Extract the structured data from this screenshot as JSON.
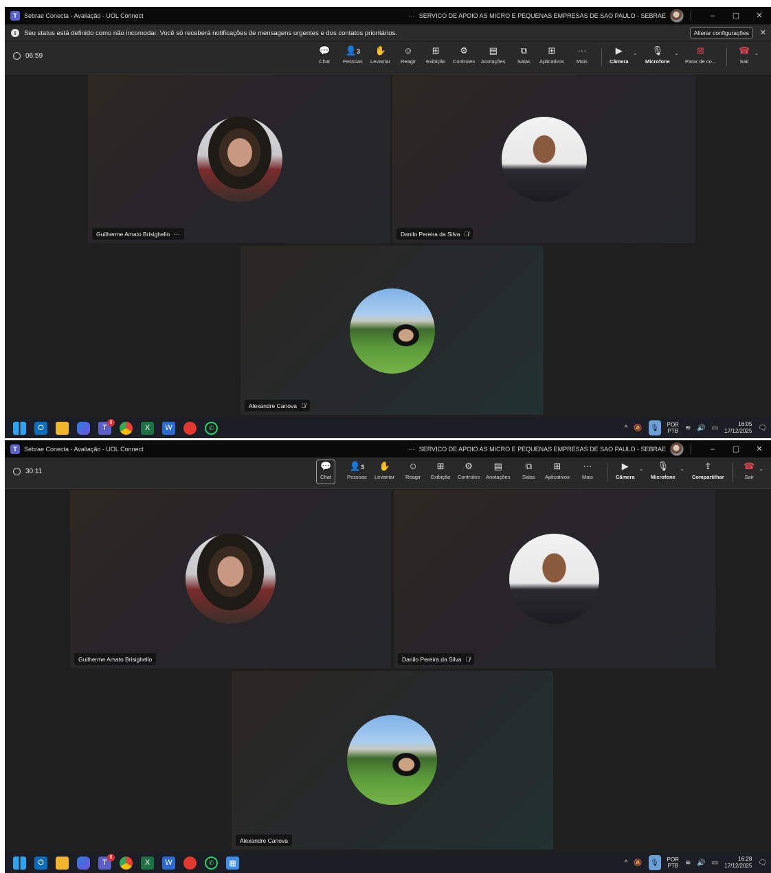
{
  "screens": [
    {
      "titlebar": {
        "app_title": "Sebrae Conecta - Avaliação - UOL Connect",
        "more": "···",
        "org_name": "SERVICO DE APOIO AS MICRO E PEQUENAS EMPRESAS DE SAO PAULO - SEBRAE",
        "minimize": "–",
        "restore": "▢",
        "close": "✕"
      },
      "banner": {
        "message": "Seu status está definido como não incomodar. Você só receberá notificações de mensagens urgentes e dos contatos prioritários.",
        "button": "Alterar configurações",
        "close": "✕"
      },
      "toolbar": {
        "timer": "06:59",
        "people_count": "3",
        "chat": "Chat",
        "people": "Pessoas",
        "raise": "Levantar",
        "react": "Reagir",
        "view": "Exibição",
        "controls": "Controles",
        "notes": "Anotações",
        "rooms": "Salas",
        "apps": "Aplicativos",
        "more": "Mais",
        "camera": "Câmera",
        "mic": "Microfone",
        "share": "Parar de co...",
        "leave": "Sair"
      },
      "participants": [
        {
          "name": "Guilherme Amato Brisighello",
          "extra": "···"
        },
        {
          "name": "Danilo Pereira da Silva",
          "extra": ""
        },
        {
          "name": "Alexandre Canova",
          "extra": ""
        }
      ],
      "taskbar": {
        "teams_badge": "6",
        "lang_top": "POR",
        "lang_bottom": "PTB",
        "time": "16:05",
        "date": "17/12/2025"
      }
    },
    {
      "titlebar": {
        "app_title": "Sebrae Conecta - Avaliação - UOL Connect",
        "more": "···",
        "org_name": "SERVICO DE APOIO AS MICRO E PEQUENAS EMPRESAS DE SAO PAULO - SEBRAE",
        "minimize": "–",
        "restore": "▢",
        "close": "✕"
      },
      "toolbar": {
        "timer": "30:11",
        "people_count": "3",
        "chat": "Chat",
        "people": "Pessoas",
        "raise": "Levantar",
        "react": "Reagir",
        "view": "Exibição",
        "controls": "Controles",
        "notes": "Anotações",
        "rooms": "Salas",
        "apps": "Aplicativos",
        "more": "Mais",
        "camera": "Câmera",
        "mic": "Microfone",
        "share": "Compartilhar",
        "leave": "Sair"
      },
      "participants": [
        {
          "name": "Guilherme Amato Brisighello",
          "extra": ""
        },
        {
          "name": "Danilo Pereira da Silva",
          "extra": ""
        },
        {
          "name": "Alexandre Canova",
          "extra": ""
        }
      ],
      "taskbar": {
        "teams_badge": "6",
        "lang_top": "POR",
        "lang_bottom": "PTB",
        "time": "16:28",
        "date": "17/12/2025"
      }
    }
  ],
  "icons": {
    "chat": "chat-bubble-icon",
    "people": "people-icon",
    "raise": "raise-hand-icon",
    "react": "smiley-icon",
    "view": "grid-icon",
    "controls": "controls-icon",
    "notes": "notes-icon",
    "rooms": "rooms-icon",
    "apps": "plus-box-icon",
    "more": "ellipsis-icon",
    "camera": "camera-off-icon",
    "mic": "microphone-icon",
    "share_stop": "stop-share-icon",
    "share": "share-arrow-icon",
    "leave": "hang-up-icon",
    "mute": "mic-muted-icon"
  },
  "colors": {
    "accent": "#5b5fc7",
    "leave_red": "#e0464f",
    "background": "#1f1f1f",
    "toolbar": "#292929"
  }
}
